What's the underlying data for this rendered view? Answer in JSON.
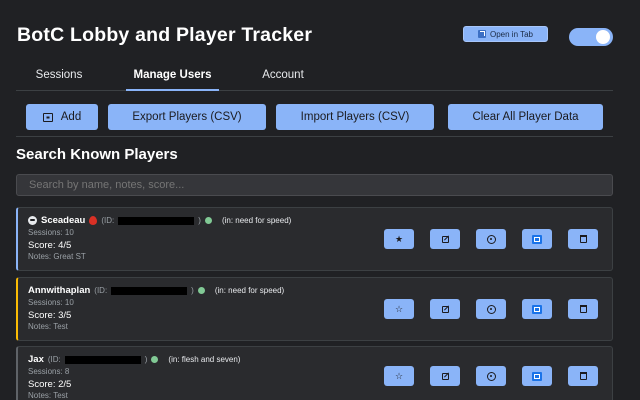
{
  "header": {
    "title": "BotC Lobby and Player Tracker",
    "open_in_tab": "Open in Tab",
    "toggle_on": true
  },
  "tabs": [
    {
      "label": "Sessions",
      "active": false
    },
    {
      "label": "Manage Users",
      "active": true
    },
    {
      "label": "Account",
      "active": false
    }
  ],
  "actions": {
    "add": "Add",
    "export": "Export Players (CSV)",
    "import": "Import Players (CSV)",
    "clear": "Clear All Player Data"
  },
  "search": {
    "title": "Search Known Players",
    "placeholder": "Search by name, notes, score..."
  },
  "players": [
    {
      "name": "Sceadeau",
      "id_label": "(ID:",
      "id_close": ")",
      "in_game": "(in: need for speed)",
      "sessions": "Sessions: 10",
      "score": "Score: 4/5",
      "notes": "Notes: Great ST",
      "status_color": "#81c995",
      "border_color": "#8ab4f8"
    },
    {
      "name": "Annwithaplan",
      "id_label": "(ID:",
      "id_close": ")",
      "in_game": "(in: need for speed)",
      "sessions": "Sessions: 10",
      "score": "Score: 3/5",
      "notes": "Notes: Test",
      "status_color": "#81c995",
      "border_color": "#fbbc04"
    },
    {
      "name": "Jax",
      "id_label": "(ID:",
      "id_close": ")",
      "in_game": "(in: flesh and seven)",
      "sessions": "Sessions: 8",
      "score": "Score: 2/5",
      "notes": "Notes: Test",
      "status_color": "#81c995",
      "border_color": "#5f6368"
    }
  ],
  "icons": {
    "favorite": "star-icon",
    "edit": "edit-icon",
    "view": "eye-icon",
    "notes": "note-icon",
    "delete": "trash-icon"
  },
  "colors": {
    "accent": "#8ab4f8",
    "background": "#202124",
    "card": "#2a2b2e"
  }
}
